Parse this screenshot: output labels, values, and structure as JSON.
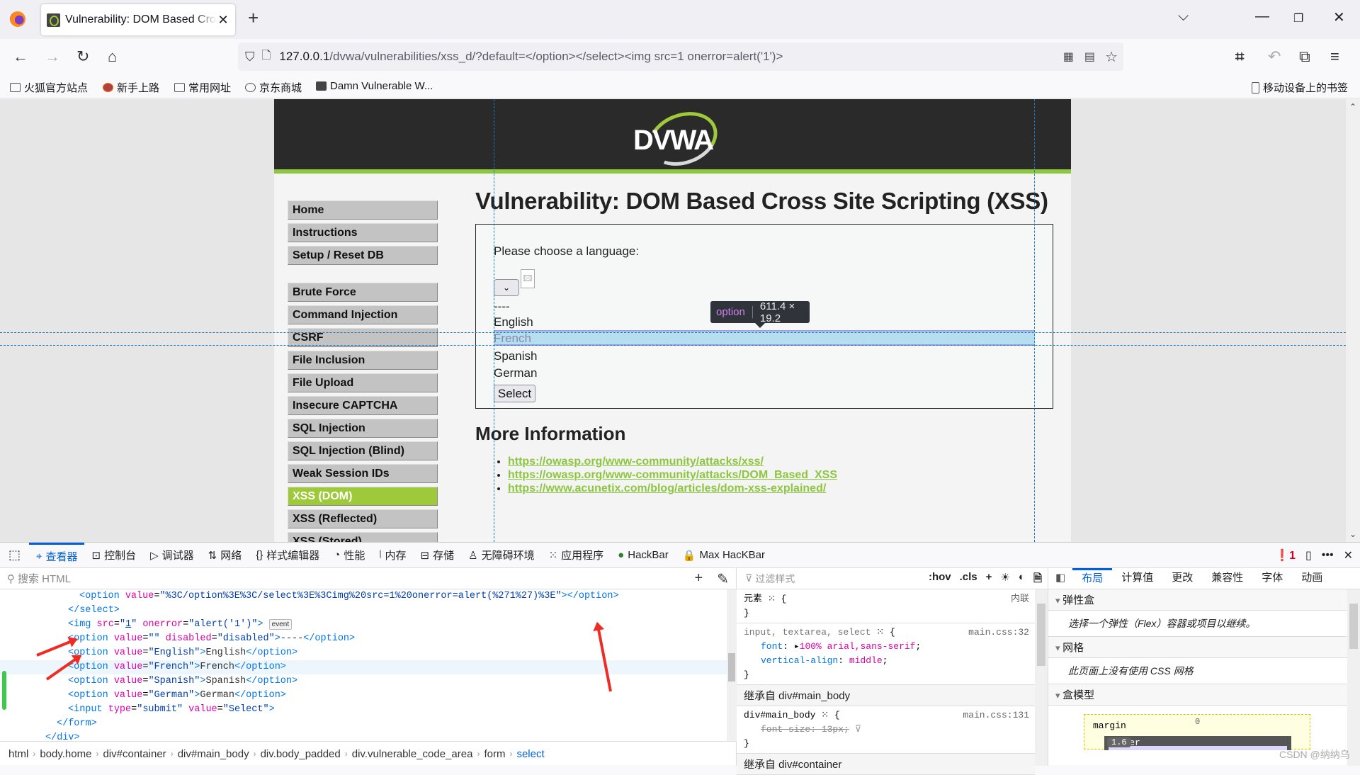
{
  "browser": {
    "tab_title": "Vulnerability: DOM Based Cross Site Scripting (XSS)",
    "url_host": "127.0.0.1",
    "url_path": "/dvwa/vulnerabilities/xss_d/?default=</option></select><img src=1 onerror=alert('1')>",
    "bookmarks": [
      {
        "icon": "folder-icon",
        "label": "火狐官方站点"
      },
      {
        "icon": "firefox-icon",
        "label": "新手上路"
      },
      {
        "icon": "folder-icon",
        "label": "常用网址"
      },
      {
        "icon": "globe-icon",
        "label": "京东商城"
      },
      {
        "icon": "dvwa-icon",
        "label": "Damn Vulnerable W..."
      }
    ],
    "mobile_bookmarks": "移动设备上的书签"
  },
  "page": {
    "logo_text": "DVWA",
    "menu": [
      {
        "label": "Home"
      },
      {
        "label": "Instructions"
      },
      {
        "label": "Setup / Reset DB"
      },
      {
        "label": "Brute Force"
      },
      {
        "label": "Command Injection"
      },
      {
        "label": "CSRF"
      },
      {
        "label": "File Inclusion"
      },
      {
        "label": "File Upload"
      },
      {
        "label": "Insecure CAPTCHA"
      },
      {
        "label": "SQL Injection"
      },
      {
        "label": "SQL Injection (Blind)"
      },
      {
        "label": "Weak Session IDs"
      },
      {
        "label": "XSS (DOM)",
        "selected": true
      },
      {
        "label": "XSS (Reflected)"
      },
      {
        "label": "XSS (Stored)"
      }
    ],
    "title": "Vulnerability: DOM Based Cross Site Scripting (XSS)",
    "choose_label": "Please choose a language:",
    "options": [
      "----",
      "English",
      "French",
      "Spanish",
      "German"
    ],
    "highlighted_option": "French",
    "select_button": "Select",
    "tooltip": {
      "tag": "option",
      "size": "611.4 × 19.2"
    },
    "more_info_heading": "More Information",
    "links": [
      "https://owasp.org/www-community/attacks/xss/",
      "https://owasp.org/www-community/attacks/DOM_Based_XSS",
      "https://www.acunetix.com/blog/articles/dom-xss-explained/"
    ]
  },
  "devtools": {
    "tabs": [
      {
        "icon": "inspector-icon",
        "label": "查看器",
        "active": true
      },
      {
        "icon": "console-icon",
        "label": "控制台"
      },
      {
        "icon": "debugger-icon",
        "label": "调试器"
      },
      {
        "icon": "network-icon",
        "label": "网络"
      },
      {
        "icon": "style-editor-icon",
        "label": "样式编辑器"
      },
      {
        "icon": "performance-icon",
        "label": "性能"
      },
      {
        "icon": "memory-icon",
        "label": "内存"
      },
      {
        "icon": "storage-icon",
        "label": "存储"
      },
      {
        "icon": "accessibility-icon",
        "label": "无障碍环境"
      },
      {
        "icon": "application-icon",
        "label": "应用程序"
      },
      {
        "icon": "hackbar-icon",
        "label": "HackBar"
      },
      {
        "icon": "max-hackbar-icon",
        "label": "Max HacKBar"
      }
    ],
    "error_count": "1",
    "search_placeholder": "搜索 HTML",
    "filter_placeholder": "过滤样式",
    "hov": ":hov",
    "cls": ".cls",
    "code_lines": [
      {
        "indent": 14,
        "html": "<span class='t'>&lt;option</span> <span class='a'>value</span>=<span class='v'>\"%3C/option%3E%3C/select%3E%3Cimg%20src=1%20onerror=alert(%271%27)%3E\"</span><span class='t'>&gt;&lt;/option&gt;</span>"
      },
      {
        "indent": 12,
        "html": "<span class='t'>&lt;/select&gt;</span>"
      },
      {
        "indent": 12,
        "html": "<span class='t'>&lt;img</span> <span class='a'>src</span>=<span class='v'>\"<u>1</u>\"</span> <span class='a'>onerror</span>=<span class='v'>\"alert('1')\"</span><span class='t'>&gt;</span> <span class='evt'>event</span>"
      },
      {
        "indent": 12,
        "html": "<span class='t'>&lt;option</span> <span class='a'>value</span>=<span class='v'>\"\"</span> <span class='a'>disabled</span>=<span class='v'>\"disabled\"</span><span class='t'>&gt;</span><span class='p'>----</span><span class='t'>&lt;/option&gt;</span>"
      },
      {
        "indent": 12,
        "html": "<span class='t'>&lt;option</span> <span class='a'>value</span>=<span class='v'>\"English\"</span><span class='t'>&gt;</span><span class='p'>English</span><span class='t'>&lt;/option&gt;</span>"
      },
      {
        "indent": 12,
        "html": "<span class='t'>&lt;option</span> <span class='a'>value</span>=<span class='v'>\"French\"</span><span class='t'>&gt;</span><span class='p'>French</span><span class='t'>&lt;/option&gt;</span>",
        "hl": true
      },
      {
        "indent": 12,
        "html": "<span class='t'>&lt;option</span> <span class='a'>value</span>=<span class='v'>\"Spanish\"</span><span class='t'>&gt;</span><span class='p'>Spanish</span><span class='t'>&lt;/option&gt;</span>"
      },
      {
        "indent": 12,
        "html": "<span class='t'>&lt;option</span> <span class='a'>value</span>=<span class='v'>\"German\"</span><span class='t'>&gt;</span><span class='p'>German</span><span class='t'>&lt;/option&gt;</span>"
      },
      {
        "indent": 12,
        "html": "<span class='t'>&lt;input</span> <span class='a'>type</span>=<span class='v'>\"submit\"</span> <span class='a'>value</span>=<span class='v'>\"Select\"</span><span class='t'>&gt;</span>"
      },
      {
        "indent": 10,
        "html": "<span class='t'>&lt;/form&gt;</span>"
      },
      {
        "indent": 8,
        "html": "<span class='t'>&lt;/div&gt;</span>"
      }
    ],
    "breadcrumbs": [
      "html",
      "body.home",
      "div#container",
      "div#main_body",
      "div.body_padded",
      "div.vulnerable_code_area",
      "form",
      "select"
    ],
    "rules": {
      "element_label": "元素",
      "inline_label": "内联",
      "rule1_selector": "input, textarea, select",
      "rule1_source": "main.css:32",
      "rule1_props": [
        {
          "name": "font",
          "value": "100% arial,sans-serif"
        },
        {
          "name": "vertical-align",
          "value": "middle"
        }
      ],
      "inherit1": "继承自 div#main_body",
      "rule2_selector": "div#main_body",
      "rule2_source": "main.css:131",
      "rule2_prop": "font-size: 13px;",
      "inherit2": "继承自 div#container"
    },
    "layout_tabs": [
      {
        "label": "布局",
        "active": true
      },
      {
        "label": "计算值"
      },
      {
        "label": "更改"
      },
      {
        "label": "兼容性"
      },
      {
        "label": "字体"
      },
      {
        "label": "动画"
      }
    ],
    "flex_heading": "弹性盒",
    "flex_body": "选择一个弹性（Flex）容器或项目以继续。",
    "grid_heading": "网格",
    "grid_body": "此页面上没有使用 CSS 网格",
    "box_heading": "盒模型",
    "box": {
      "margin_label": "margin",
      "margin_value": "0",
      "border_label": "border",
      "border_value": "1.6"
    }
  },
  "watermark": "CSDN @纳纳乌"
}
